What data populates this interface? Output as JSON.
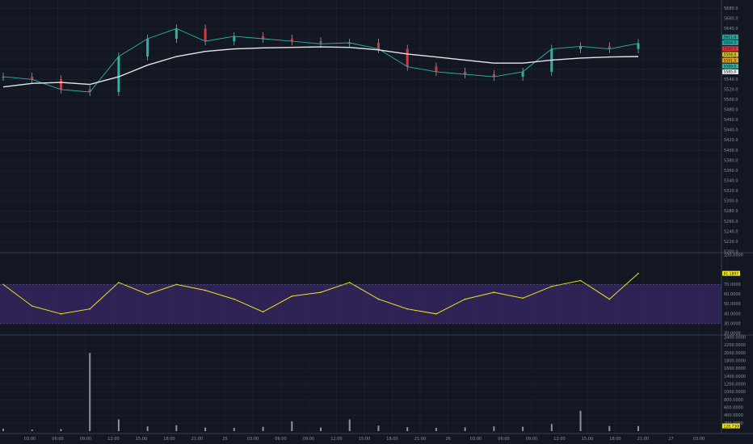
{
  "colors": {
    "background": "#131722",
    "grid": "#1f2533",
    "price_candle": "#c9cdd6",
    "ema_fast": "#2bb3a3",
    "ema_mid": "#d4c21e",
    "ema_slow": "#e5a11c",
    "ma_long": "#e6e6e6",
    "ma_red": "#e0343a",
    "rsi_line": "#f1e419",
    "rsi_band": "#3b2a6a",
    "volume_bar": "#8d919b",
    "last_price_tag": "#26a69a"
  },
  "price_axis": {
    "ticks": [
      "5680.0",
      "5660.0",
      "5640.0",
      "5620.0",
      "5600.0",
      "5580.0",
      "5560.0",
      "5540.0",
      "5520.0",
      "5500.0",
      "5480.0",
      "5460.0",
      "5440.0",
      "5420.0",
      "5400.0",
      "5380.0",
      "5360.0",
      "5340.0",
      "5320.0",
      "5300.0",
      "5280.0",
      "5260.0",
      "5240.0",
      "5220.0",
      "5200.0"
    ],
    "tags": [
      {
        "text": "5611.0",
        "color": "#26a69a"
      },
      {
        "text": "5604.5",
        "color": "#26a69a"
      },
      {
        "text": "5597.0",
        "color": "#e0343a"
      },
      {
        "text": "5594.0",
        "color": "#d4c21e"
      },
      {
        "text": "5591.5",
        "color": "#e5a11c"
      },
      {
        "text": "5589.0",
        "color": "#2bb3a3"
      },
      {
        "text": "5585.0",
        "color": "#e6e6e6"
      }
    ]
  },
  "rsi_axis": {
    "ticks": [
      "100.0000",
      "80.0000",
      "70.0000",
      "60.0000",
      "50.0000",
      "40.0000",
      "30.0000",
      "20.0000"
    ],
    "value_tag": "81.1897"
  },
  "volume_axis": {
    "ticks": [
      "2400.0000",
      "2200.0000",
      "2000.0000",
      "1800.0000",
      "1600.0000",
      "1400.0000",
      "1200.0000",
      "1000.0000",
      "800.0000",
      "600.0000",
      "400.0000",
      "200.0000"
    ],
    "value_tag": "128.7300"
  },
  "time_axis": {
    "labels": [
      "03:00",
      "06:00",
      "09:00",
      "12:00",
      "15:00",
      "18:00",
      "21:00",
      "25",
      "03:00",
      "06:00",
      "09:00",
      "12:00",
      "15:00",
      "18:00",
      "21:00",
      "26",
      "03:00",
      "06:00",
      "09:00",
      "12:00",
      "15:00",
      "18:00",
      "21:00",
      "27",
      "03:00",
      "06:00"
    ]
  },
  "chart_data": [
    {
      "type": "candlestick",
      "title": "",
      "x": [
        "03:00",
        "06:00",
        "09:00",
        "12:00",
        "15:00",
        "18:00",
        "21:00",
        "25",
        "03:00",
        "06:00",
        "09:00",
        "12:00",
        "15:00",
        "18:00",
        "21:00",
        "26",
        "03:00",
        "06:00",
        "09:00",
        "12:00",
        "15:00",
        "18:00",
        "21:00"
      ],
      "series": [
        {
          "name": "",
          "role": "close",
          "values": [
            5545,
            5540,
            5520,
            5515,
            5585,
            5620,
            5640,
            5615,
            5625,
            5620,
            5615,
            5610,
            5612,
            5600,
            5565,
            5555,
            5550,
            5545,
            5555,
            5600,
            5605,
            5600,
            5611
          ]
        },
        {
          "name": "",
          "role": "long-ma",
          "values": [
            5525,
            5532,
            5534,
            5530,
            5545,
            5568,
            5585,
            5595,
            5600,
            5602,
            5603,
            5604,
            5603,
            5598,
            5590,
            5584,
            5578,
            5572,
            5572,
            5578,
            5582,
            5584,
            5585
          ]
        }
      ],
      "ylim": [
        5200,
        5690
      ]
    },
    {
      "type": "line",
      "title": "",
      "series": [
        {
          "name": "",
          "values": [
            70,
            48,
            40,
            45,
            72,
            60,
            70,
            64,
            55,
            42,
            58,
            62,
            72,
            55,
            45,
            40,
            55,
            62,
            56,
            68,
            74,
            55,
            81.1897
          ]
        }
      ],
      "ylim": [
        20,
        100
      ],
      "band": [
        30,
        70
      ]
    },
    {
      "type": "bar",
      "title": "",
      "series": [
        {
          "name": "",
          "values": [
            60,
            40,
            50,
            2000,
            300,
            120,
            150,
            90,
            80,
            110,
            250,
            90,
            300,
            140,
            100,
            85,
            95,
            120,
            110,
            180,
            520,
            130,
            128.73
          ]
        }
      ],
      "ylim": [
        0,
        2400
      ]
    }
  ]
}
